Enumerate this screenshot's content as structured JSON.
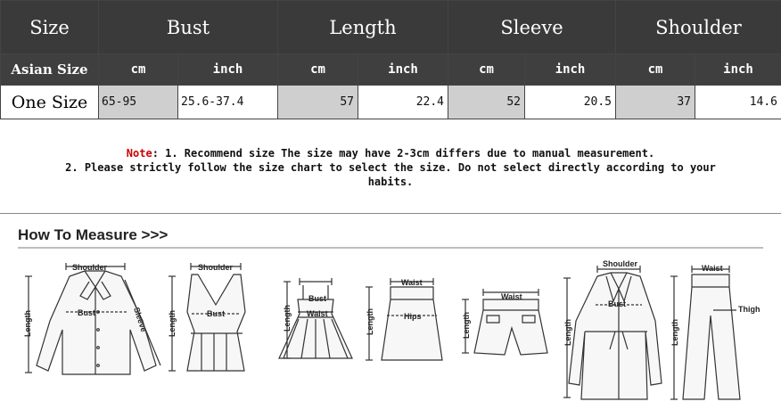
{
  "table": {
    "headers": [
      "Size",
      "Bust",
      "Length",
      "Sleeve",
      "Shoulder"
    ],
    "subheaders": [
      "Asian Size",
      "cm",
      "inch",
      "cm",
      "inch",
      "cm",
      "inch",
      "cm",
      "inch"
    ],
    "row": [
      "One Size",
      "65-95",
      "25.6-37.4",
      "57",
      "22.4",
      "52",
      "20.5",
      "37",
      "14.6"
    ]
  },
  "note": {
    "label": "Note",
    "line1": ": 1. Recommend size  The size may have 2-3cm differs due to manual measurement.",
    "line2": "2. Please strictly follow the size chart to select the size. Do not select directly according to your",
    "line3": "habits."
  },
  "measure": {
    "title": "How To Measure >>>",
    "labels": {
      "shoulder": "Shoulder",
      "bust": "Bust",
      "length": "Length",
      "sleeve": "Sleeve",
      "waist": "Waist",
      "hips": "Hips",
      "thigh": "Thigh"
    }
  }
}
